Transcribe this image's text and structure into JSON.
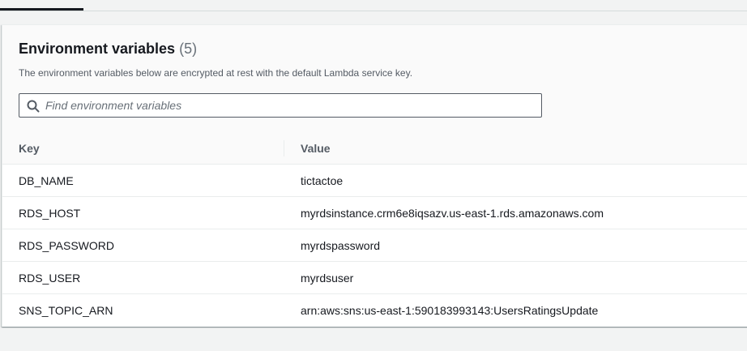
{
  "panel": {
    "title": "Environment variables",
    "count": "(5)",
    "description": "The environment variables below are encrypted at rest with the default Lambda service key."
  },
  "search": {
    "placeholder": "Find environment variables",
    "value": "",
    "icon": "search-icon"
  },
  "table": {
    "columns": [
      "Key",
      "Value"
    ],
    "rows": [
      {
        "key": "DB_NAME",
        "value": "tictactoe"
      },
      {
        "key": "RDS_HOST",
        "value": "myrdsinstance.crm6e8iqsazv.us-east-1.rds.amazonaws.com"
      },
      {
        "key": "RDS_PASSWORD",
        "value": "myrdspassword"
      },
      {
        "key": "RDS_USER",
        "value": "myrdsuser"
      },
      {
        "key": "SNS_TOPIC_ARN",
        "value": "arn:aws:sns:us-east-1:590183993143:UsersRatingsUpdate"
      }
    ]
  },
  "colors": {
    "page_background": "#f2f3f3",
    "text": "#16191f",
    "muted_text": "#687078"
  }
}
